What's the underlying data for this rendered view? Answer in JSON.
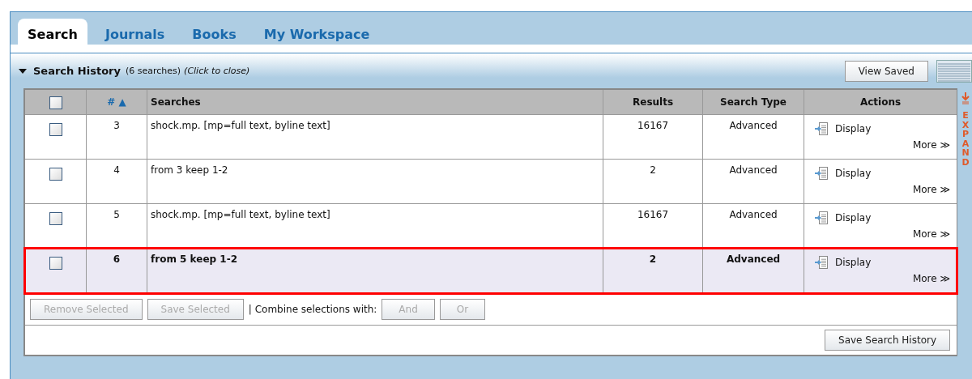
{
  "tabs": [
    {
      "label": "Search",
      "selected": true
    },
    {
      "label": "Journals",
      "selected": false
    },
    {
      "label": "Books",
      "selected": false
    },
    {
      "label": "My Workspace",
      "selected": false
    }
  ],
  "panel": {
    "title": "Search History",
    "count": "(6 searches)",
    "toggle_hint": "(Click to close)",
    "expanded": true,
    "view_saved": "View Saved",
    "expand_label": "EXPAND"
  },
  "table": {
    "columns": [
      "#",
      "Searches",
      "Results",
      "Search Type",
      "Actions"
    ],
    "sort_mark": "▲",
    "select_all_checked": false,
    "rows": [
      {
        "num": "3",
        "search": "shock.mp. [mp=full text, byline text]",
        "results": "16167",
        "type": "Advanced",
        "display": "Display",
        "more": "More ≫",
        "checked": false,
        "highlighted": false
      },
      {
        "num": "4",
        "search": "from 3 keep 1-2",
        "results": "2",
        "type": "Advanced",
        "display": "Display",
        "more": "More ≫",
        "checked": false,
        "highlighted": false
      },
      {
        "num": "5",
        "search": "shock.mp. [mp=full text, byline text]",
        "results": "16167",
        "type": "Advanced",
        "display": "Display",
        "more": "More ≫",
        "checked": false,
        "highlighted": false
      },
      {
        "num": "6",
        "search": "from 5 keep 1-2",
        "results": "2",
        "type": "Advanced",
        "display": "Display",
        "more": "More ≫",
        "checked": false,
        "highlighted": true
      }
    ]
  },
  "actions": {
    "remove": "Remove Selected",
    "save": "Save Selected",
    "combine_label": "| Combine selections with:",
    "and": "And",
    "or": "Or",
    "disabled": true
  },
  "save_history": "Save Search History"
}
